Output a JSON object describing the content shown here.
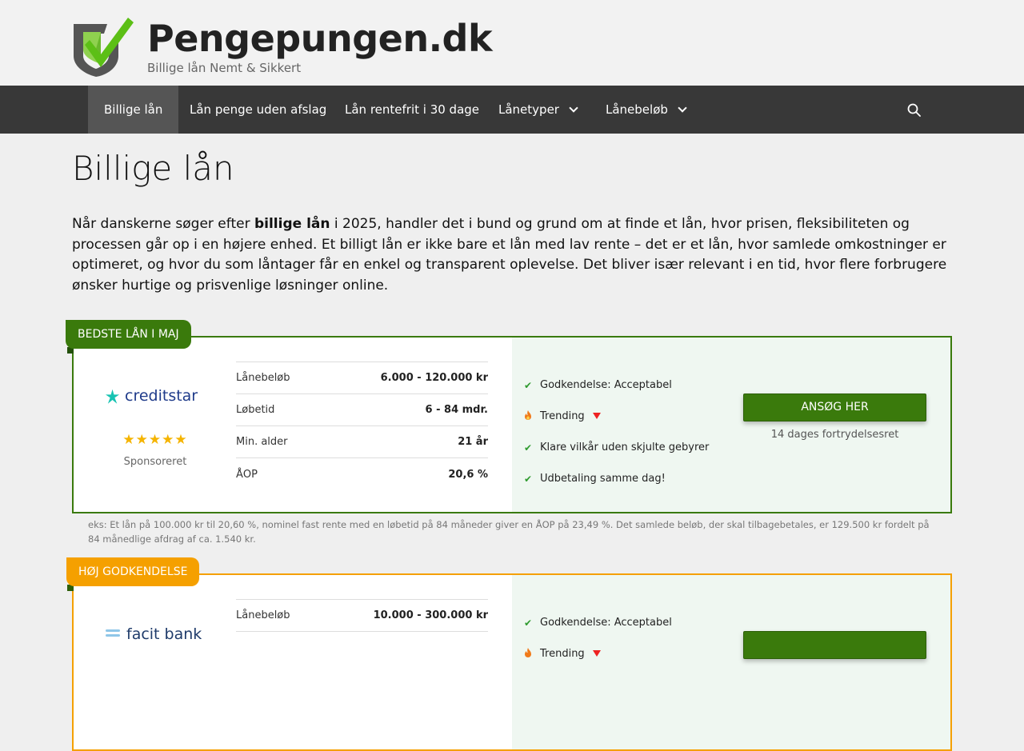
{
  "site": {
    "title": "Pengepungen.dk",
    "tagline": "Billige lån Nemt & Sikkert"
  },
  "nav": {
    "items": [
      {
        "label": "Billige lån",
        "active": true
      },
      {
        "label": "Lån penge uden afslag"
      },
      {
        "label": "Lån rentefrit i 30 dage"
      },
      {
        "label": "Lånetyper",
        "dropdown": true
      },
      {
        "label": "Lånebeløb",
        "dropdown": true
      }
    ],
    "search_icon": "search-icon"
  },
  "page": {
    "title": "Billige lån",
    "intro_before": "Når danskerne søger efter ",
    "intro_bold": "billige lån",
    "intro_after": " i 2025, handler det i bund og grund om at finde et lån, hvor prisen, fleksibiliteten og processen går op i en højere enhed. Et billigt lån er ikke bare et lån med lav rente – det er et lån, hvor samlede omkostninger er optimeret, og hvor du som låntager får en enkel og transparent oplevelse. Det bliver især relevant i en tid, hvor flere forbrugere ønsker hurtige og prisvenlige løsninger online."
  },
  "offers": [
    {
      "ribbon": "BEDSTE LÅN I MAJ",
      "ribbon_color": "#3a7a0c",
      "brand": "creditstar",
      "stars": "★★★★★",
      "sponsor": "Sponsoreret",
      "specs": [
        {
          "k": "Lånebeløb",
          "v": "6.000 - 120.000 kr"
        },
        {
          "k": "Løbetid",
          "v": "6 - 84 mdr."
        },
        {
          "k": "Min. alder",
          "v": "21 år"
        },
        {
          "k": "ÅOP",
          "v": "20,6 %"
        }
      ],
      "features": [
        {
          "icon": "check",
          "text": "Godkendelse: Acceptabel"
        },
        {
          "icon": "fire",
          "text": "Trending"
        },
        {
          "icon": "check",
          "text": "Klare vilkår uden skjulte gebyrer"
        },
        {
          "icon": "check",
          "text": "Udbetaling samme dag!"
        }
      ],
      "button": "ANSØG HER",
      "regret": "14 dages fortrydelsesret",
      "disclaimer": "eks: Et lån på 100.000 kr til 20,60 %, nominel fast rente med en løbetid på 84 måneder giver en ÅOP på 23,49 %. Det samlede beløb, der skal tilbagebetales, er 129.500 kr fordelt på 84 månedlige afdrag af ca. 1.540 kr."
    },
    {
      "ribbon": "HØJ GODKENDELSE",
      "ribbon_color": "#f5a000",
      "brand": "facit bank",
      "specs": [
        {
          "k": "Lånebeløb",
          "v": "10.000 - 300.000 kr"
        }
      ],
      "features": [
        {
          "icon": "check",
          "text": "Godkendelse: Acceptabel"
        },
        {
          "icon": "fire",
          "text": "Trending"
        }
      ]
    }
  ]
}
